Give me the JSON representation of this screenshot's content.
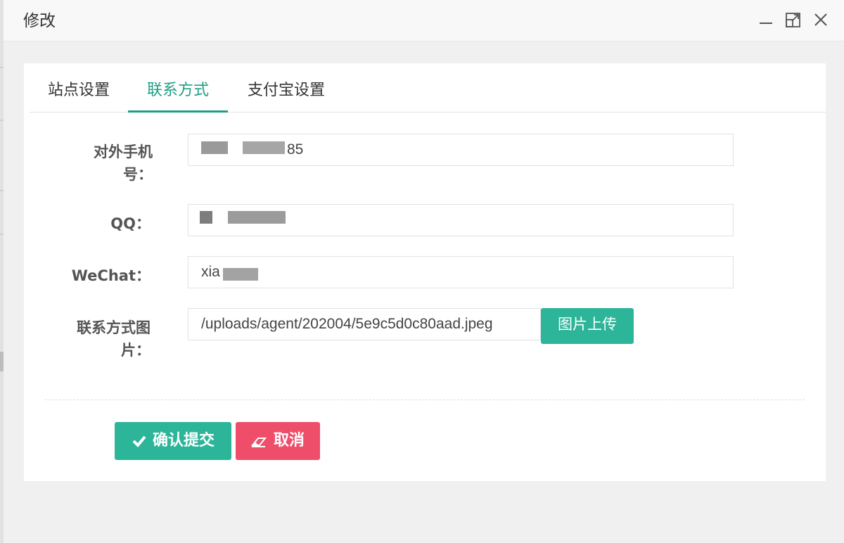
{
  "dialog": {
    "title": "修改",
    "controls": {
      "minimize_icon": "minimize-icon",
      "maximize_icon": "maximize-icon",
      "close_icon": "close-icon"
    }
  },
  "tabs": [
    {
      "label": "站点设置",
      "active": false
    },
    {
      "label": "联系方式",
      "active": true
    },
    {
      "label": "支付宝设置",
      "active": false
    }
  ],
  "form": {
    "phone": {
      "label": "对外手机号：",
      "value": "85"
    },
    "qq": {
      "label": "QQ：",
      "value": ""
    },
    "wechat": {
      "label": "WeChat：",
      "value": "xia"
    },
    "image": {
      "label": "联系方式图片：",
      "value": "/uploads/agent/202004/5e9c5d0c80aad.jpeg",
      "upload_label": "图片上传"
    }
  },
  "actions": {
    "submit_label": "确认提交",
    "submit_icon": "check-icon",
    "cancel_label": "取消",
    "cancel_icon": "eraser-icon"
  },
  "colors": {
    "accent": "#1e9f84",
    "button_green": "#2db59a",
    "button_red": "#ee4e6a"
  }
}
